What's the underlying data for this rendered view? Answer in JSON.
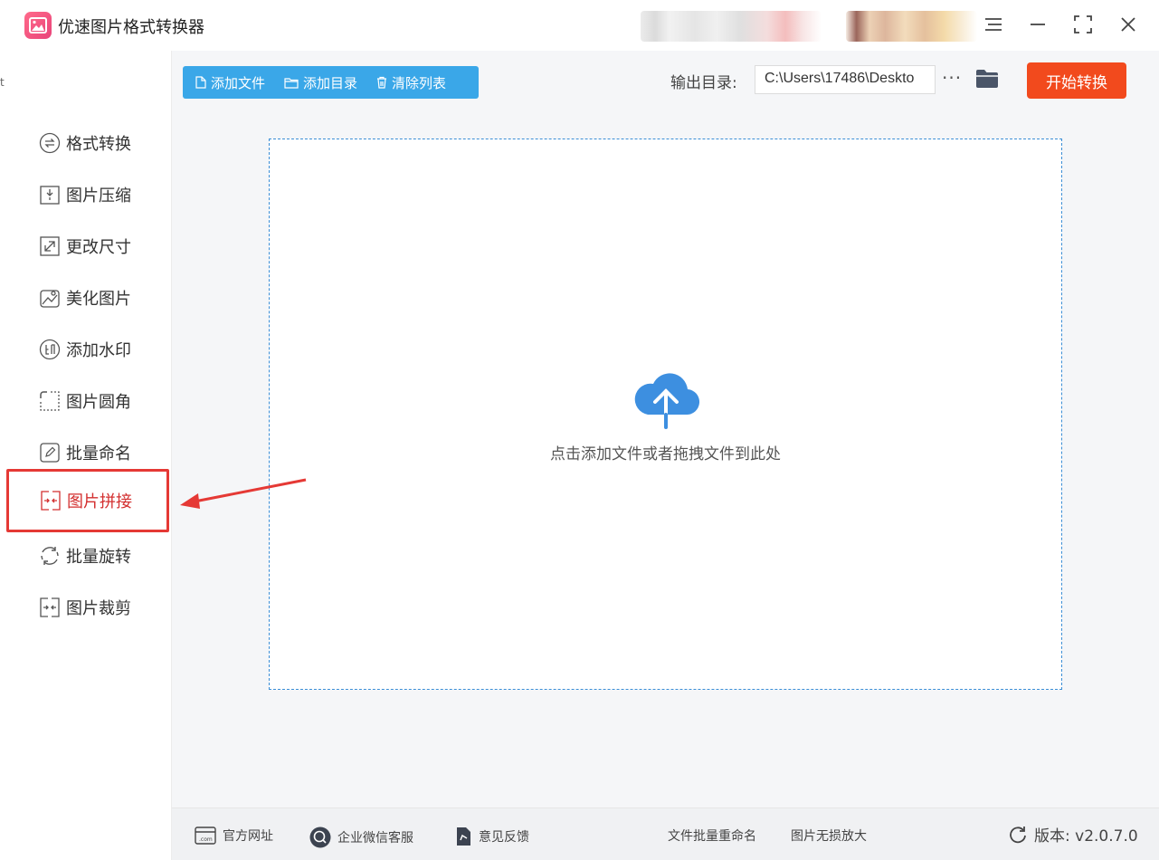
{
  "app": {
    "title": "优速图片格式转换器"
  },
  "window_controls": {
    "menu_icon": "hamburger-icon",
    "minimize_icon": "minimize-icon",
    "maximize_icon": "maximize-icon",
    "close_icon": "close-icon"
  },
  "sidebar": {
    "items": [
      {
        "label": "格式转换",
        "icon": "convert-icon"
      },
      {
        "label": "图片压缩",
        "icon": "compress-icon"
      },
      {
        "label": "更改尺寸",
        "icon": "resize-icon"
      },
      {
        "label": "美化图片",
        "icon": "beautify-icon"
      },
      {
        "label": "添加水印",
        "icon": "watermark-icon"
      },
      {
        "label": "图片圆角",
        "icon": "round-corner-icon"
      },
      {
        "label": "批量命名",
        "icon": "rename-icon"
      },
      {
        "label": "图片拼接",
        "icon": "stitch-icon",
        "active": true
      },
      {
        "label": "批量旋转",
        "icon": "rotate-icon"
      },
      {
        "label": "图片裁剪",
        "icon": "crop-icon"
      }
    ]
  },
  "toolbar": {
    "add_file": "添加文件",
    "add_folder": "添加目录",
    "clear_list": "清除列表",
    "output_label": "输出目录:",
    "output_path": "C:\\Users\\17486\\Deskto",
    "more_label": "···",
    "start": "开始转换"
  },
  "drop_zone": {
    "hint": "点击添加文件或者拖拽文件到此处",
    "icon": "cloud-upload-icon"
  },
  "footer": {
    "website": "官方网址",
    "wechat": "企业微信客服",
    "feedback": "意见反馈",
    "batch_rename": "文件批量重命名",
    "lossless": "图片无损放大",
    "version": "版本:  v2.0.7.0"
  },
  "colors": {
    "accent_blue": "#3aa7e8",
    "start_orange": "#f24a1d",
    "active_red": "#e53935",
    "cloud_blue": "#3d8fe0"
  }
}
